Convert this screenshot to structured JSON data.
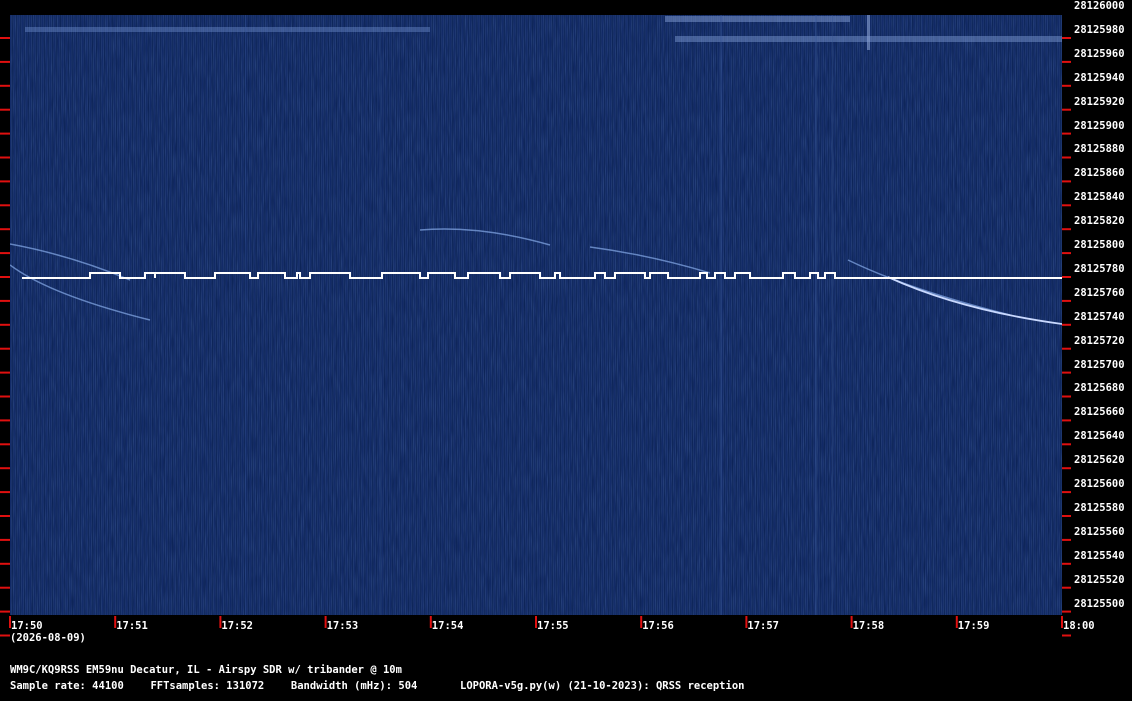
{
  "y_axis": {
    "labels": [
      "28126000",
      "28125980",
      "28125960",
      "28125940",
      "28125920",
      "28125900",
      "28125880",
      "28125860",
      "28125840",
      "28125820",
      "28125800",
      "28125780",
      "28125760",
      "28125740",
      "28125720",
      "28125700",
      "28125680",
      "28125660",
      "28125640",
      "28125620",
      "28125600",
      "28125580",
      "28125560",
      "28125540",
      "28125520",
      "28125500"
    ]
  },
  "x_axis": {
    "labels": [
      "17:50",
      "17:51",
      "17:52",
      "17:53",
      "17:54",
      "17:55",
      "17:56",
      "17:57",
      "17:58",
      "17:59",
      "18:00"
    ],
    "date": "(2026-08-09)"
  },
  "footer": {
    "station": "WM9C/KQ9RSS EM59nu Decatur, IL - Airspy SDR w/ tribander @ 10m",
    "sample_rate": "Sample rate: 44100",
    "fft_samples": "FFTsamples: 131072",
    "bandwidth": "Bandwidth (mHz): 504",
    "software": "LOPORA-v5g.py(w) (21-10-2023): QRSS reception"
  },
  "colors": {
    "background": "#0a1f55",
    "tick": "#e01010",
    "signal": "#ffffff"
  },
  "signal": {
    "carrier_freq_hz": 28125776
  }
}
